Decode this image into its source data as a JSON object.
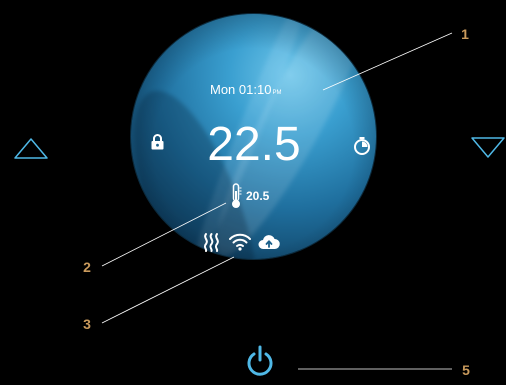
{
  "display": {
    "clock": {
      "day": "Mon",
      "time": "01:10",
      "ampm": "PM"
    },
    "setpoint": "22.5",
    "room_temperature": "20.5"
  },
  "icons": {
    "lock": "lock-icon",
    "timer": "timer-icon",
    "sensor": "thermometer-icon",
    "heating": "heating-icon",
    "wifi": "wifi-icon",
    "cloud": "cloud-upload-icon",
    "up": "arrow-up-icon",
    "down": "arrow-down-icon",
    "power": "power-icon"
  },
  "callouts": [
    "1",
    "2",
    "3",
    "5"
  ],
  "colors": {
    "background": "#000000",
    "dial": "#1f6f9e",
    "arrows": "#4fb8e6",
    "callout": "#c99a5c",
    "text": "#ffffff"
  }
}
